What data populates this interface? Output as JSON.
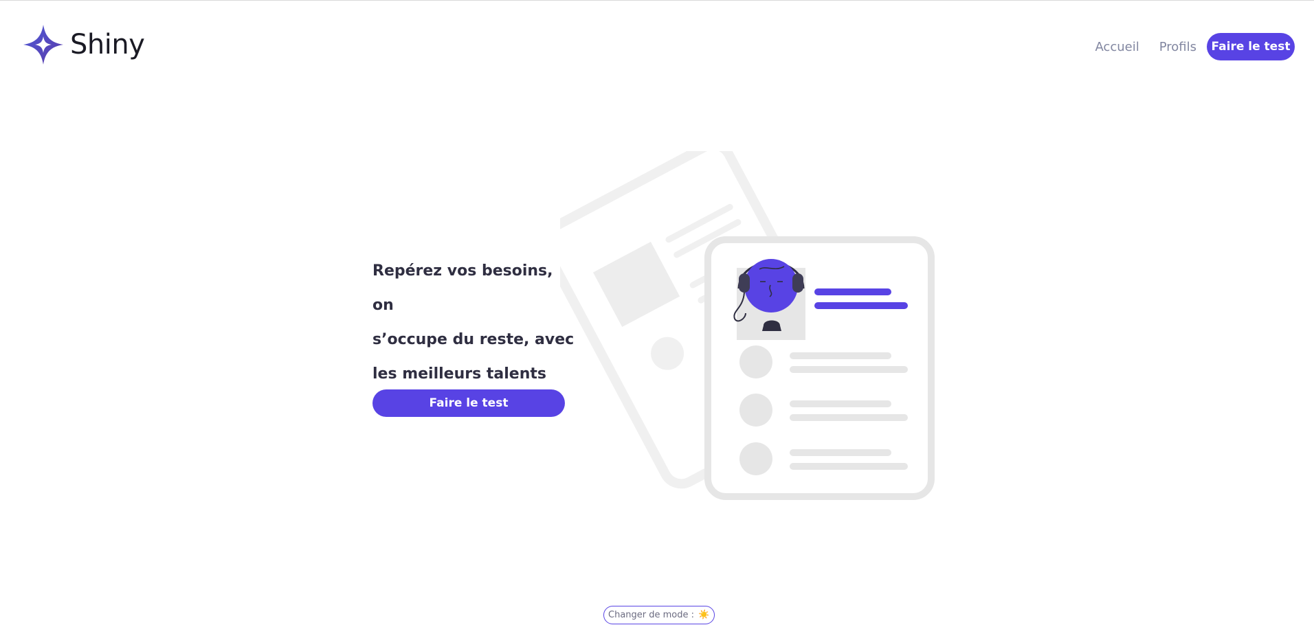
{
  "header": {
    "logo_text": "Shiny",
    "nav": [
      {
        "label": "Accueil"
      },
      {
        "label": "Profils"
      }
    ],
    "cta_label": "Faire le test"
  },
  "hero": {
    "title_lines": [
      "Repérez vos besoins, on",
      "s’occupe du reste, avec",
      "les meilleurs talents"
    ],
    "cta_label": "Faire le test",
    "illustration_icon": "profile-card-illustration"
  },
  "footer": {
    "mode_label": "Changer de mode :",
    "mode_icon": "☀️"
  },
  "colors": {
    "primary": "#5843e4",
    "text_dark": "#2f2e41",
    "nav_text": "#8186a0",
    "light_gray": "#e6e6e6"
  }
}
